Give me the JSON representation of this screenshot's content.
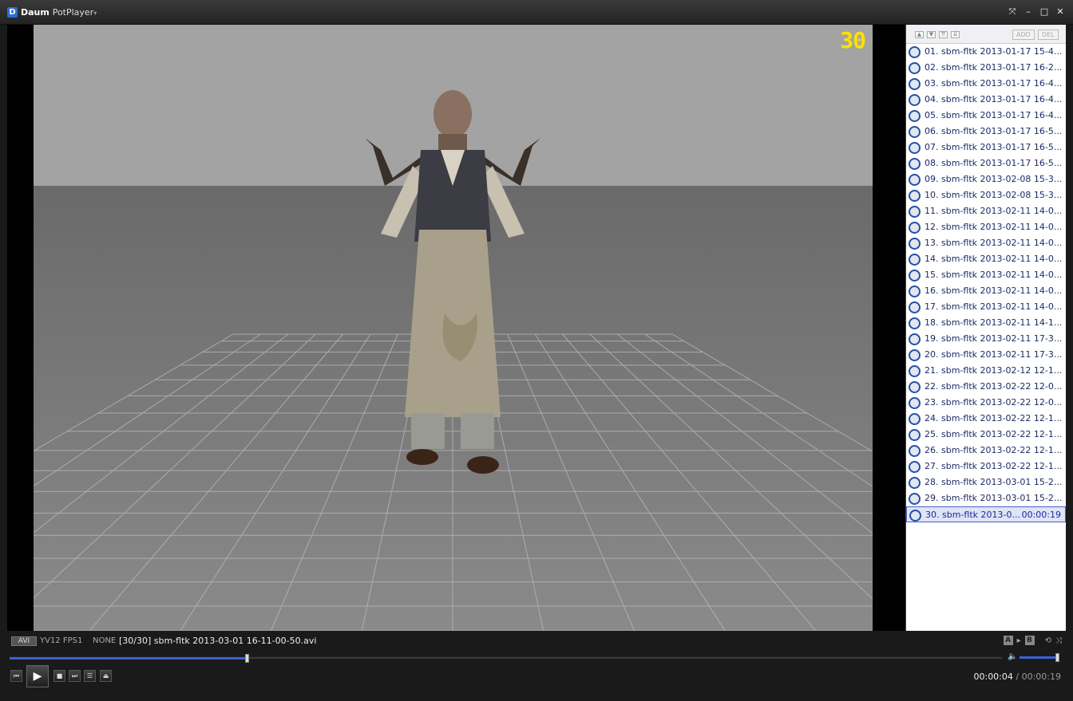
{
  "window": {
    "logo_letter": "D",
    "brand": "Daum",
    "product": "PotPlayer",
    "menu_caret": "▾",
    "buttons": {
      "pin": "⤧",
      "minimize": "–",
      "maximize": "□",
      "close": "✕"
    }
  },
  "video": {
    "frame_counter": "30"
  },
  "playlist": {
    "toolbar": {
      "add_label": "ADD",
      "del_label": "DEL"
    },
    "items": [
      {
        "label": "01. sbm-fltk 2013-01-17 15-4..."
      },
      {
        "label": "02. sbm-fltk 2013-01-17 16-2..."
      },
      {
        "label": "03. sbm-fltk 2013-01-17 16-4..."
      },
      {
        "label": "04. sbm-fltk 2013-01-17 16-4..."
      },
      {
        "label": "05. sbm-fltk 2013-01-17 16-4..."
      },
      {
        "label": "06. sbm-fltk 2013-01-17 16-5..."
      },
      {
        "label": "07. sbm-fltk 2013-01-17 16-5..."
      },
      {
        "label": "08. sbm-fltk 2013-01-17 16-5..."
      },
      {
        "label": "09. sbm-fltk 2013-02-08 15-3..."
      },
      {
        "label": "10. sbm-fltk 2013-02-08 15-3..."
      },
      {
        "label": "11. sbm-fltk 2013-02-11 14-0..."
      },
      {
        "label": "12. sbm-fltk 2013-02-11 14-0..."
      },
      {
        "label": "13. sbm-fltk 2013-02-11 14-0..."
      },
      {
        "label": "14. sbm-fltk 2013-02-11 14-0..."
      },
      {
        "label": "15. sbm-fltk 2013-02-11 14-0..."
      },
      {
        "label": "16. sbm-fltk 2013-02-11 14-0..."
      },
      {
        "label": "17. sbm-fltk 2013-02-11 14-0..."
      },
      {
        "label": "18. sbm-fltk 2013-02-11 14-1..."
      },
      {
        "label": "19. sbm-fltk 2013-02-11 17-3..."
      },
      {
        "label": "20. sbm-fltk 2013-02-11 17-3..."
      },
      {
        "label": "21. sbm-fltk 2013-02-12 12-1..."
      },
      {
        "label": "22. sbm-fltk 2013-02-22 12-0..."
      },
      {
        "label": "23. sbm-fltk 2013-02-22 12-0..."
      },
      {
        "label": "24. sbm-fltk 2013-02-22 12-1..."
      },
      {
        "label": "25. sbm-fltk 2013-02-22 12-1..."
      },
      {
        "label": "26. sbm-fltk 2013-02-22 12-1..."
      },
      {
        "label": "27. sbm-fltk 2013-02-22 12-1..."
      },
      {
        "label": "28. sbm-fltk 2013-03-01 15-2..."
      },
      {
        "label": "29. sbm-fltk 2013-03-01 15-2..."
      },
      {
        "label": "30. sbm-fltk 2013-0...",
        "duration": "00:00:19",
        "active": true
      }
    ]
  },
  "status": {
    "container": "AVI",
    "video_format": "YV12",
    "fps_label": "FPS1",
    "audio": "NONE",
    "file_title": "[30/30] sbm-fltk 2013-03-01 16-11-00-50.avi",
    "ab_a": "A",
    "ab_arrow": "▸",
    "ab_b": "B",
    "repeat_icon": "⟲",
    "shuffle_icon": "⤨"
  },
  "playback": {
    "progress": 0.24,
    "volume": 0.95,
    "current_time": "00:00:04",
    "separator": " / ",
    "total_time": "00:00:19",
    "volume_icon": "🔈"
  },
  "controls": {
    "prev": "⏮",
    "play": "▶",
    "stop": "■",
    "next": "⏭",
    "playlist_toggle": "☰",
    "eject": "⏏"
  },
  "colors": {
    "accent": "#3c62d8",
    "frame_counter": "#ffe000",
    "active_item_bg": "#dfe4f7"
  }
}
